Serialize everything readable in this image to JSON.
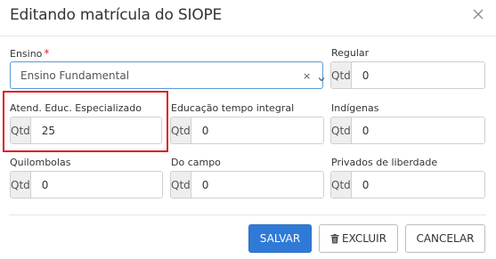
{
  "dialog": {
    "title": "Editando matrícula do SIOPE"
  },
  "form": {
    "ensino": {
      "label": "Ensino",
      "required_mark": "*",
      "selected": "Ensino Fundamental",
      "clear_glyph": "×"
    },
    "addon_label": "Qtd",
    "fields": {
      "regular": {
        "label": "Regular",
        "value": "0"
      },
      "atend_educ": {
        "label": "Atend. Educ. Especializado",
        "value": "25"
      },
      "educacao_integral": {
        "label": "Educação tempo integral",
        "value": "0"
      },
      "indigenas": {
        "label": "Indígenas",
        "value": "0"
      },
      "quilombolas": {
        "label": "Quilombolas",
        "value": "0"
      },
      "do_campo": {
        "label": "Do campo",
        "value": "0"
      },
      "privados": {
        "label": "Privados de liberdade",
        "value": "0"
      }
    }
  },
  "footer": {
    "save_label": "SALVAR",
    "delete_label": "EXCLUIR",
    "cancel_label": "CANCELAR"
  },
  "colors": {
    "primary": "#2f7ad6",
    "highlight": "#e0151f",
    "required": "#d9262c"
  },
  "icons": {
    "close": "close-icon",
    "chevron": "chevron-down-icon",
    "trash": "trash-icon"
  }
}
